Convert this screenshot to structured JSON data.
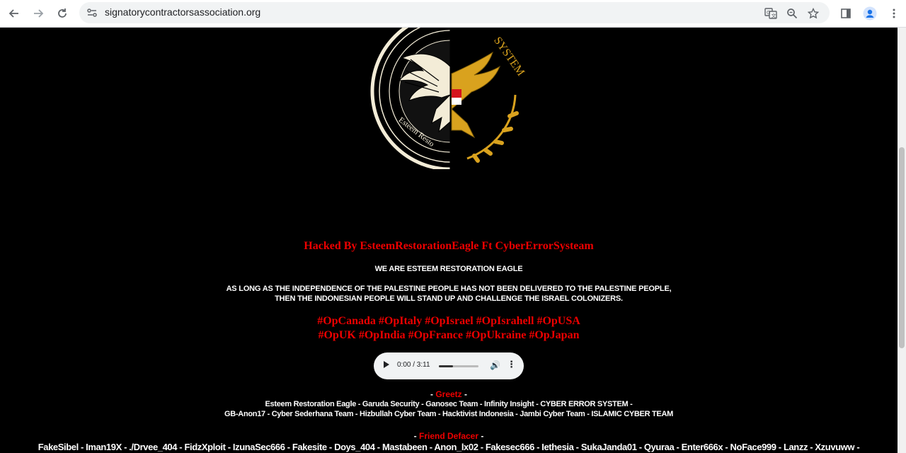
{
  "browser": {
    "url": "signatorycontractorsassociation.org",
    "icons": [
      "back-arrow-icon",
      "forward-arrow-icon",
      "reload-icon",
      "site-info-icon",
      "translate-icon",
      "zoom-icon",
      "bookmark-star-icon",
      "side-panel-icon",
      "profile-icon",
      "menu-icon"
    ]
  },
  "page": {
    "logo_text_left": "Esteem Resto",
    "logo_text_right": "SYSTEM",
    "headline": "Hacked By EsteemRestorationEagle Ft CyberErrorSysteam",
    "subhead": "WE ARE ESTEEM RESTORATION EAGLE",
    "message_line1": "AS LONG AS THE INDEPENDENCE OF THE PALESTINE PEOPLE HAS NOT BEEN DELIVERED TO THE PALESTINE PEOPLE,",
    "message_line2": "THEN THE INDONESIAN PEOPLE WILL STAND UP AND CHALLENGE THE ISRAEL COLONIZERS.",
    "ops_line1": "#OpCanada #OpItaly #OpIsrael #OpIsrahell #OpUSA",
    "ops_line2": "#OpUK #OpIndia #OpFrance #OpUkraine #OpJapan",
    "audio": {
      "time": "0:00 / 3:11",
      "volume_level": 1.0
    },
    "greetz": {
      "prefix": "- ",
      "label": "Greetz",
      "suffix": " -",
      "line1": "Esteem Restoration Eagle - Garuda Security - Ganosec Team - Infinity Insight - CYBER ERROR SYSTEM -",
      "line2": "GB-Anon17 - Cyber Sederhana Team - Hizbullah Cyber Team - Hacktivist Indonesia - Jambi Cyber Team - ISLAMIC CYBER TEAM"
    },
    "friends": {
      "prefix": "- ",
      "label": "Friend Defacer",
      "suffix": " -",
      "line1": "FakeSibel - Iman19X - ./Drvee_404 - FidzXploit - IzunaSec666 - Fakesite - Doys_404 - Mastabeen - Anon_lx02 - Fakesec666 - Iethesia - SukaJanda01 - Qyuraa - Enter666x - NoFace999 - Lanzz - Xzuvuww -"
    }
  }
}
